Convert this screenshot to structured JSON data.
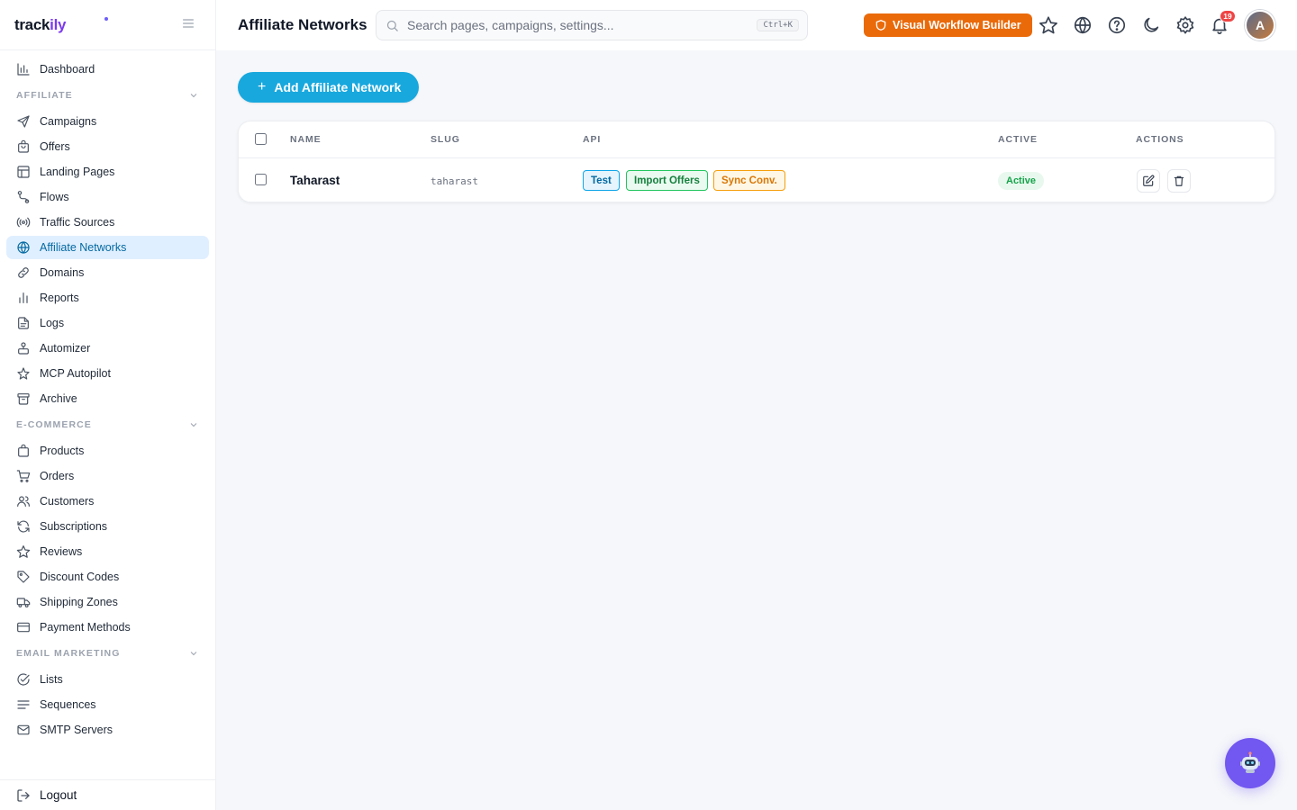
{
  "brand": {
    "logo_main": "track",
    "logo_accent": "ily"
  },
  "header": {
    "title": "Affiliate Networks",
    "search_placeholder": "Search pages, campaigns, settings...",
    "search_shortcut": "Ctrl+K",
    "workflow_button": "Visual Workflow Builder",
    "notification_count": "19",
    "avatar_initial": "A",
    "icons": [
      "star-icon",
      "globe-icon",
      "help-icon",
      "moon-icon",
      "settings-icon",
      "bell-icon"
    ]
  },
  "sidebar": {
    "top": {
      "label": "Dashboard",
      "icon": "chart-icon"
    },
    "sections": [
      {
        "title": "AFFILIATE",
        "items": [
          {
            "label": "Campaigns",
            "icon": "send-icon"
          },
          {
            "label": "Offers",
            "icon": "bag-icon"
          },
          {
            "label": "Landing Pages",
            "icon": "layout-icon"
          },
          {
            "label": "Flows",
            "icon": "route-icon"
          },
          {
            "label": "Traffic Sources",
            "icon": "radio-icon"
          },
          {
            "label": "Affiliate Networks",
            "icon": "globe-icon",
            "active": true
          },
          {
            "label": "Domains",
            "icon": "link-icon"
          },
          {
            "label": "Reports",
            "icon": "bar-chart-icon"
          },
          {
            "label": "Logs",
            "icon": "file-icon"
          },
          {
            "label": "Automizer",
            "icon": "robot-icon"
          },
          {
            "label": "MCP Autopilot",
            "icon": "sparkle-icon"
          },
          {
            "label": "Archive",
            "icon": "archive-icon"
          }
        ]
      },
      {
        "title": "E-COMMERCE",
        "items": [
          {
            "label": "Products",
            "icon": "box-icon"
          },
          {
            "label": "Orders",
            "icon": "cart-icon"
          },
          {
            "label": "Customers",
            "icon": "users-icon"
          },
          {
            "label": "Subscriptions",
            "icon": "refresh-icon"
          },
          {
            "label": "Reviews",
            "icon": "star-icon"
          },
          {
            "label": "Discount Codes",
            "icon": "tag-icon"
          },
          {
            "label": "Shipping Zones",
            "icon": "truck-icon"
          },
          {
            "label": "Payment Methods",
            "icon": "card-icon"
          }
        ]
      },
      {
        "title": "EMAIL MARKETING",
        "items": [
          {
            "label": "Lists",
            "icon": "check-circle-icon"
          },
          {
            "label": "Sequences",
            "icon": "lines-icon"
          },
          {
            "label": "SMTP Servers",
            "icon": "mail-icon"
          }
        ]
      }
    ],
    "logout": "Logout"
  },
  "main": {
    "add_button": "Add Affiliate Network",
    "table": {
      "columns": [
        "NAME",
        "SLUG",
        "API",
        "ACTIVE",
        "ACTIONS"
      ],
      "rows": [
        {
          "name": "Taharast",
          "slug": "taharast",
          "api_buttons": [
            "Test",
            "Import Offers",
            "Sync Conv."
          ],
          "status": "Active"
        }
      ]
    }
  },
  "colors": {
    "accent": "#18a8de",
    "workflow": "#ea6a0a",
    "active_nav_bg": "#e0efff",
    "bot_button": "#7257f0",
    "badge": "#ef4444"
  }
}
